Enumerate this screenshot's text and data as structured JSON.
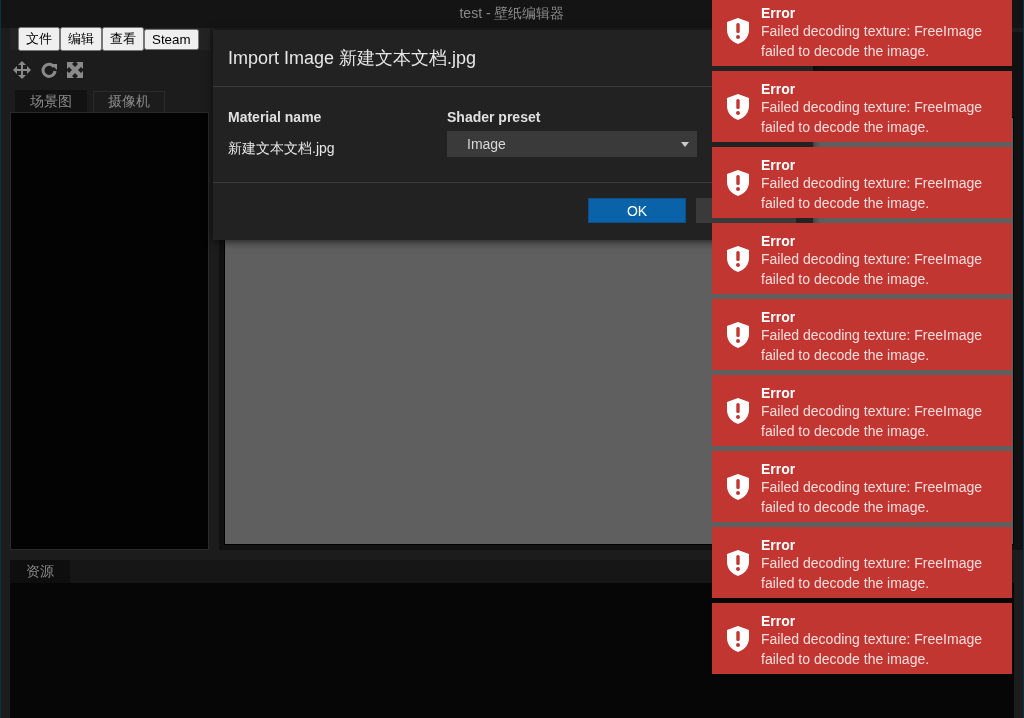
{
  "window": {
    "title": "test - 壁纸编辑器"
  },
  "menu": [
    "文件",
    "编辑",
    "查看",
    "Steam"
  ],
  "scene_tabs": [
    {
      "label": "场景图",
      "selected": true
    },
    {
      "label": "摄像机",
      "selected": false
    }
  ],
  "bottom_tabs": [
    {
      "label": "资源",
      "selected": true
    }
  ],
  "dialog": {
    "title": "Import Image 新建文本文档.jpg",
    "fields": [
      {
        "kind": "text",
        "label": "Material name",
        "value": "新建文本文档.jpg"
      },
      {
        "kind": "dropdown",
        "label": "Shader preset",
        "value": "Image"
      }
    ],
    "ok_button": "OK"
  },
  "notifications": [
    {
      "title": "Error",
      "message": "Failed decoding texture: FreeImage failed to decode the image."
    },
    {
      "title": "Error",
      "message": "Failed decoding texture: FreeImage failed to decode the image."
    },
    {
      "title": "Error",
      "message": "Failed decoding texture: FreeImage failed to decode the image."
    },
    {
      "title": "Error",
      "message": "Failed decoding texture: FreeImage failed to decode the image."
    },
    {
      "title": "Error",
      "message": "Failed decoding texture: FreeImage failed to decode the image."
    },
    {
      "title": "Error",
      "message": "Failed decoding texture: FreeImage failed to decode the image."
    },
    {
      "title": "Error",
      "message": "Failed decoding texture: FreeImage failed to decode the image."
    },
    {
      "title": "Error",
      "message": "Failed decoding texture: FreeImage failed to decode the image."
    },
    {
      "title": "Error",
      "message": "Failed decoding texture: FreeImage failed to decode the image."
    }
  ]
}
